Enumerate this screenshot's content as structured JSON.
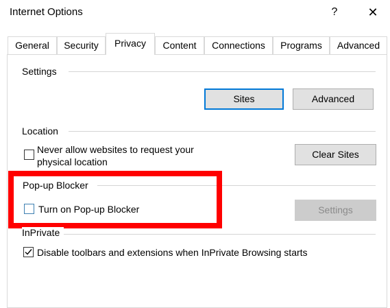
{
  "window": {
    "title": "Internet Options",
    "help_label": "?",
    "close_label": "✕"
  },
  "tabs": [
    {
      "label": "General"
    },
    {
      "label": "Security"
    },
    {
      "label": "Privacy",
      "active": true
    },
    {
      "label": "Content"
    },
    {
      "label": "Connections"
    },
    {
      "label": "Programs"
    },
    {
      "label": "Advanced"
    }
  ],
  "settings": {
    "header": "Settings",
    "sites_button": "Sites",
    "advanced_button": "Advanced"
  },
  "location": {
    "header": "Location",
    "never_allow_line1": "Never allow websites to request your",
    "never_allow_line2": "physical location",
    "never_allow_checked": false,
    "clear_sites_button": "Clear Sites"
  },
  "popup": {
    "header": "Pop-up Blocker",
    "turn_on_label": "Turn on Pop-up Blocker",
    "turn_on_checked": false,
    "settings_button": "Settings"
  },
  "inprivate": {
    "header": "InPrivate",
    "disable_label": "Disable toolbars and extensions when InPrivate Browsing starts",
    "disable_checked": true
  },
  "colors": {
    "highlight": "#ff0000",
    "default_button_border": "#0078d7"
  }
}
